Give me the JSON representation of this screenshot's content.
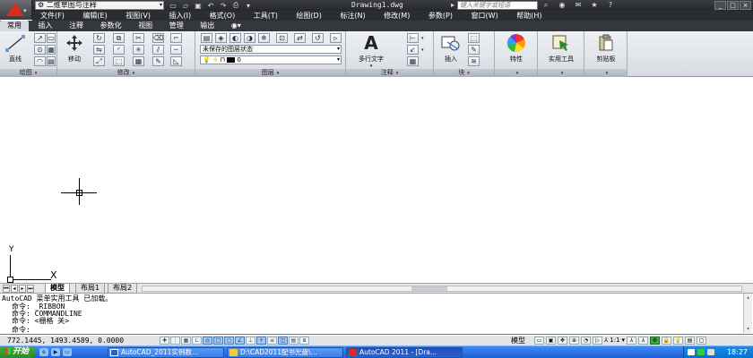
{
  "title_bar": {
    "workspace": "二维草图与注释",
    "document_title": "Drawing1.dwg",
    "search_placeholder": "键入关键字或短语",
    "win_buttons": [
      "_",
      "□",
      "×"
    ]
  },
  "menu": [
    "文件(F)",
    "编辑(E)",
    "视图(V)",
    "插入(I)",
    "格式(O)",
    "工具(T)",
    "绘图(D)",
    "标注(N)",
    "修改(M)",
    "参数(P)",
    "窗口(W)",
    "帮助(H)"
  ],
  "ribbon_tabs": [
    "常用",
    "插入",
    "注释",
    "参数化",
    "视图",
    "管理",
    "输出"
  ],
  "ribbon": {
    "draw": {
      "line": "直线",
      "panel": "绘图"
    },
    "modify": {
      "move": "移动",
      "panel": "修改"
    },
    "layers": {
      "state": "未保存的图层状态",
      "current_layer": "0",
      "panel": "图层"
    },
    "annotation": {
      "mtext": "多行文字",
      "panel": "注释"
    },
    "block": {
      "insert": "插入",
      "panel": "块"
    },
    "properties": {
      "label": "特性"
    },
    "utilities": {
      "label": "实用工具"
    },
    "clipboard": {
      "label": "剪贴板"
    }
  },
  "layout_tabs": [
    "模型",
    "布局1",
    "布局2"
  ],
  "ucs": {
    "x": "X",
    "y": "Y"
  },
  "command_lines": [
    "AutoCAD 菜单实用工具 已加载。",
    "命令: _RIBBON",
    "命令: COMMANDLINE",
    "命令:  <栅格 关>",
    "命令:"
  ],
  "status": {
    "coords": "772.1445,  1493.4589, 0.0000",
    "model": "模型",
    "scale": "1:1"
  },
  "taskbar": {
    "start": "开始",
    "tasks": [
      "AutoCAD_2011实例教...",
      "D:\\CAD2011配书光盘\\...",
      "AutoCAD 2011 - [Dra..."
    ],
    "time": "18:27"
  }
}
